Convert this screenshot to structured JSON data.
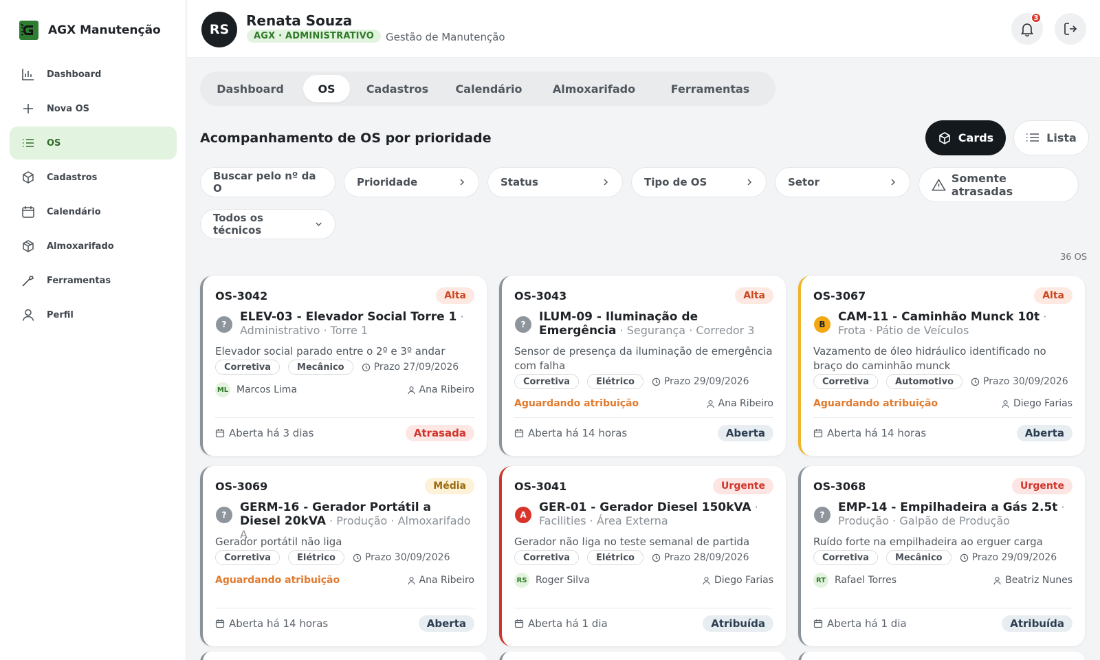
{
  "app": {
    "name": "AGX Manutenção",
    "brand_color": "#2e7d32"
  },
  "sidebar": {
    "items": [
      {
        "label": "Dashboard",
        "icon": "bar-chart-icon"
      },
      {
        "label": "Nova OS",
        "icon": "plus-icon"
      },
      {
        "label": "OS",
        "icon": "list-icon",
        "active": true
      },
      {
        "label": "Cadastros",
        "icon": "box-icon"
      },
      {
        "label": "Calendário",
        "icon": "calendar-icon"
      },
      {
        "label": "Almoxarifado",
        "icon": "package-icon"
      },
      {
        "label": "Ferramentas",
        "icon": "wrench-icon"
      },
      {
        "label": "Perfil",
        "icon": "user-icon"
      }
    ]
  },
  "header": {
    "initials": "RS",
    "user_name": "Renata Souza",
    "role": "AGX · ADMINISTRATIVO",
    "module": "Gestão de Manutenção",
    "notifications": "3"
  },
  "tabs": [
    "Dashboard",
    "OS",
    "Cadastros",
    "Calendário",
    "Almoxarifado",
    "Ferramentas"
  ],
  "section": {
    "title": "Acompanhamento de OS por prioridade",
    "view_cards": "Cards",
    "view_list": "Lista"
  },
  "filters": {
    "search_placeholder": "Buscar pelo nº da O",
    "priority": "Prioridade",
    "status": "Status",
    "type": "Tipo de OS",
    "sector": "Setor",
    "late_only": "Somente atrasadas",
    "technicians": "Todos os técnicos"
  },
  "count": "36 OS",
  "cards": [
    {
      "id": "OS-3042",
      "priority": "Alta",
      "equip_icon": "?",
      "equipment": "ELEV-03 - Elevador Social Torre 1",
      "location": "Administrativo · Torre 1",
      "description": "Elevador social parado entre o 2º e 3º andar",
      "type": "Corretiva",
      "specialty": "Mecânico",
      "deadline": "Prazo 27/09/2026",
      "tech_initials": "ML",
      "technician": "Marcos Lima",
      "requester": "Ana Ribeiro",
      "opened": "Aberta há 3 dias",
      "status": "Atrasada"
    },
    {
      "id": "OS-3043",
      "priority": "Alta",
      "equip_icon": "?",
      "equipment": "ILUM-09 - Iluminação de Emergência",
      "location": "Segurança · Corredor 3",
      "description": "Sensor de presença da iluminação de emergência com falha",
      "type": "Corretiva",
      "specialty": "Elétrico",
      "deadline": "Prazo 29/09/2026",
      "pending": "Aguardando atribuição",
      "requester": "Ana Ribeiro",
      "opened": "Aberta há 14 horas",
      "status": "Aberta"
    },
    {
      "id": "OS-3067",
      "priority": "Alta",
      "equip_icon": "B",
      "equipment": "CAM-11 - Caminhão Munck 10t",
      "location": "Frota · Pátio de Veículos",
      "description": "Vazamento de óleo hidráulico identificado no braço do caminhão munck",
      "type": "Corretiva",
      "specialty": "Automotivo",
      "deadline": "Prazo 30/09/2026",
      "pending": "Aguardando atribuição",
      "requester": "Diego Farias",
      "opened": "Aberta há 14 horas",
      "status": "Aberta"
    },
    {
      "id": "OS-3069",
      "priority": "Média",
      "equip_icon": "?",
      "equipment": "GERM-16 - Gerador Portátil a Diesel 20kVA",
      "location": "Produção · Almoxarifado A",
      "description": "Gerador portátil não liga",
      "type": "Corretiva",
      "specialty": "Elétrico",
      "deadline": "Prazo 30/09/2026",
      "pending": "Aguardando atribuição",
      "requester": "Ana Ribeiro",
      "opened": "Aberta há 14 horas",
      "status": "Aberta"
    },
    {
      "id": "OS-3041",
      "priority": "Urgente",
      "equip_icon": "A",
      "equipment": "GER-01 - Gerador Diesel 150kVA",
      "location": "Facilities · Área Externa",
      "description": "Gerador não liga no teste semanal de partida",
      "type": "Corretiva",
      "specialty": "Elétrico",
      "deadline": "Prazo 28/09/2026",
      "tech_initials": "RS",
      "technician": "Roger Silva",
      "requester": "Diego Farias",
      "opened": "Aberta há 1 dia",
      "status": "Atribuída"
    },
    {
      "id": "OS-3068",
      "priority": "Urgente",
      "equip_icon": "?",
      "equipment": "EMP-14 - Empilhadeira a Gás 2.5t",
      "location": "Produção · Galpão de Produção",
      "description": "Ruído forte na empilhadeira ao erguer carga",
      "type": "Corretiva",
      "specialty": "Mecânico",
      "deadline": "Prazo 29/09/2026",
      "tech_initials": "RT",
      "technician": "Rafael Torres",
      "requester": "Beatriz Nunes",
      "opened": "Aberta há 1 dia",
      "status": "Atribuída"
    }
  ]
}
